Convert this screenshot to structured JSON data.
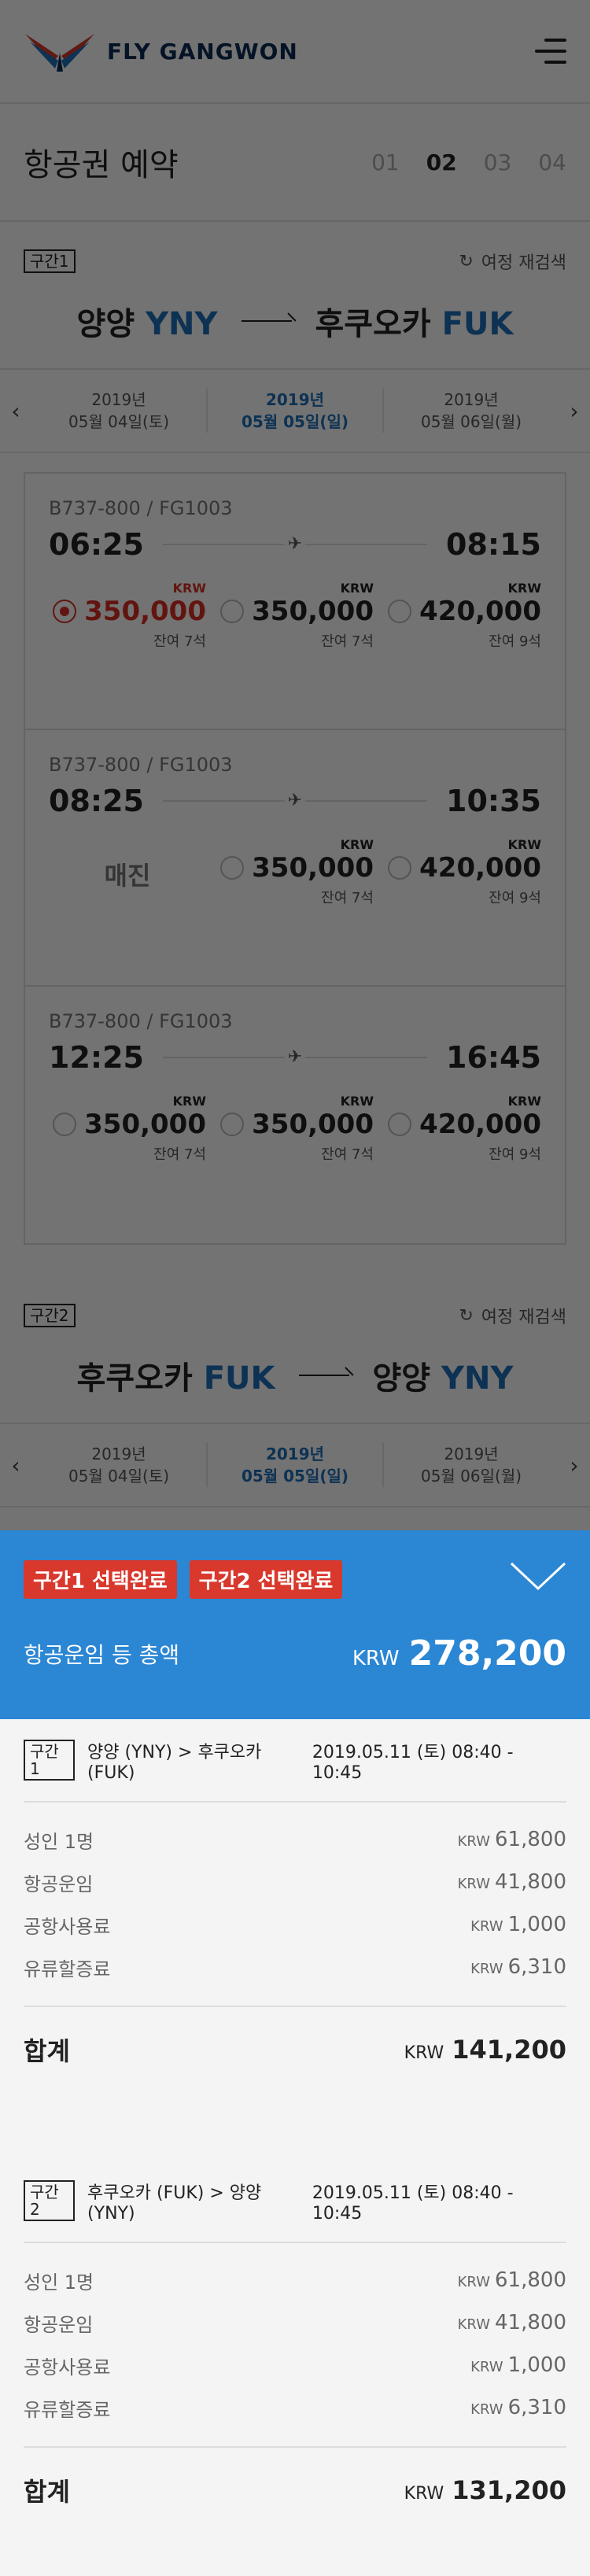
{
  "header": {
    "logo_text": "FLY GANGWON"
  },
  "title": {
    "label": "항공권 예약",
    "steps": [
      "01",
      "02",
      "03",
      "04"
    ]
  },
  "segment1": {
    "badge": "구간1",
    "research": "여정 재검색",
    "from": "양양",
    "from_code": "YNY",
    "to": "후쿠오카",
    "to_code": "FUK",
    "dates": [
      {
        "year": "2019년",
        "day": "05월 04일(토)"
      },
      {
        "year": "2019년",
        "day": "05월 05일(일)"
      },
      {
        "year": "2019년",
        "day": "05월 06일(월)"
      }
    ],
    "flights": [
      {
        "aircraft": "B737-800 / FG1003",
        "dep": "06:25",
        "arr": "08:15",
        "fares": [
          {
            "krw": "KRW",
            "price": "350,000",
            "seats": "잔여 7석"
          },
          {
            "krw": "KRW",
            "price": "350,000",
            "seats": "잔여 7석"
          },
          {
            "krw": "KRW",
            "price": "420,000",
            "seats": "잔여 9석"
          }
        ]
      },
      {
        "aircraft": "B737-800 / FG1003",
        "dep": "08:25",
        "arr": "10:35",
        "soldout": "매진",
        "fares": [
          {
            "krw": "KRW",
            "price": "350,000",
            "seats": "잔여 7석"
          },
          {
            "krw": "KRW",
            "price": "420,000",
            "seats": "잔여 9석"
          }
        ]
      },
      {
        "aircraft": "B737-800 / FG1003",
        "dep": "12:25",
        "arr": "16:45",
        "fares": [
          {
            "krw": "KRW",
            "price": "350,000",
            "seats": "잔여 7석"
          },
          {
            "krw": "KRW",
            "price": "350,000",
            "seats": "잔여 7석"
          },
          {
            "krw": "KRW",
            "price": "420,000",
            "seats": "잔여 9석"
          }
        ]
      }
    ]
  },
  "segment2": {
    "badge": "구간2",
    "research": "여정 재검색",
    "from": "후쿠오카",
    "from_code": "FUK",
    "to": "양양",
    "to_code": "YNY",
    "dates": [
      {
        "year": "2019년",
        "day": "05월 04일(토)"
      },
      {
        "year": "2019년",
        "day": "05월 05일(일)"
      },
      {
        "year": "2019년",
        "day": "05월 06일(월)"
      }
    ]
  },
  "summary": {
    "badges": [
      "구간1 선택완료",
      "구간2 선택완료"
    ],
    "total_label": "항공운임 등 총액",
    "currency": "KRW",
    "total": "278,200",
    "legs": [
      {
        "badge": "구간1",
        "route": "양양 (YNY) > 후쿠오카 (FUK)",
        "datetime": "2019.05.11 (토) 08:40 - 10:45",
        "items": [
          {
            "label": "성인 1명",
            "amount": "61,800"
          },
          {
            "label": "항공운임",
            "amount": "41,800"
          },
          {
            "label": "공항사용료",
            "amount": "1,000"
          },
          {
            "label": "유류할증료",
            "amount": "6,310"
          }
        ],
        "sum_label": "합계",
        "sum": "141,200"
      },
      {
        "badge": "구간2",
        "route": "후쿠오카 (FUK) > 양양 (YNY)",
        "datetime": "2019.05.11 (토) 08:40 - 10:45",
        "items": [
          {
            "label": "성인 1명",
            "amount": "61,800"
          },
          {
            "label": "항공운임",
            "amount": "41,800"
          },
          {
            "label": "공항사용료",
            "amount": "1,000"
          },
          {
            "label": "유류할증료",
            "amount": "6,310"
          }
        ],
        "sum_label": "합계",
        "sum": "131,200"
      }
    ]
  },
  "colors": {
    "accent_blue": "#2b86d3",
    "code_blue": "#1d6fb8",
    "red": "#d9382d",
    "navy": "#0d2a55"
  }
}
